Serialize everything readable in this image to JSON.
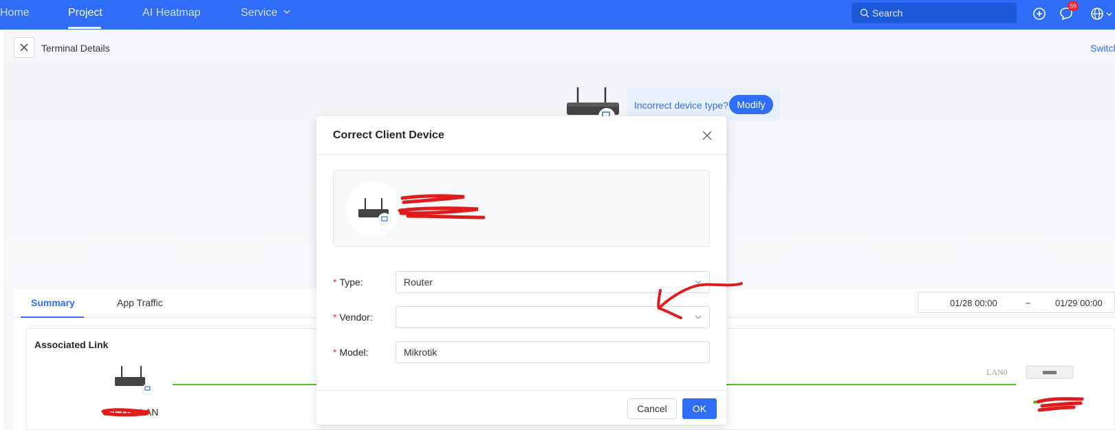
{
  "nav": {
    "items": [
      {
        "label": "Home"
      },
      {
        "label": "Project"
      },
      {
        "label": "AI Heatmap"
      },
      {
        "label": "Service"
      }
    ],
    "search_placeholder": "Search",
    "message_badge": "59",
    "icons": [
      "search-icon",
      "add-circle-icon",
      "message-icon",
      "globe-icon",
      "chevron-down-icon"
    ]
  },
  "page": {
    "title": "Terminal Details",
    "switch_link": "Switch",
    "device_tip": "Incorrect device type?",
    "modify_label": "Modify"
  },
  "tabs": [
    {
      "label": "Summary"
    },
    {
      "label": "App Traffic"
    }
  ],
  "date_range": {
    "start": "01/28 00:00",
    "separator": "~",
    "end": "01/29 00:00"
  },
  "associated_link": {
    "title": "Associated Link",
    "client_label": "L2TP-LAN",
    "port_label": "LAN0",
    "status_color": "#52c41a"
  },
  "modal": {
    "title": "Correct Client Device",
    "fields": {
      "type": {
        "label": "Type:",
        "value": "Router"
      },
      "vendor": {
        "label": "Vendor:",
        "value": ""
      },
      "model": {
        "label": "Model:",
        "value": "Mikrotik"
      }
    },
    "cancel_label": "Cancel",
    "ok_label": "OK"
  },
  "colors": {
    "primary": "#2f6df6",
    "required": "#f5222d",
    "annotation": "#e01b1b"
  }
}
